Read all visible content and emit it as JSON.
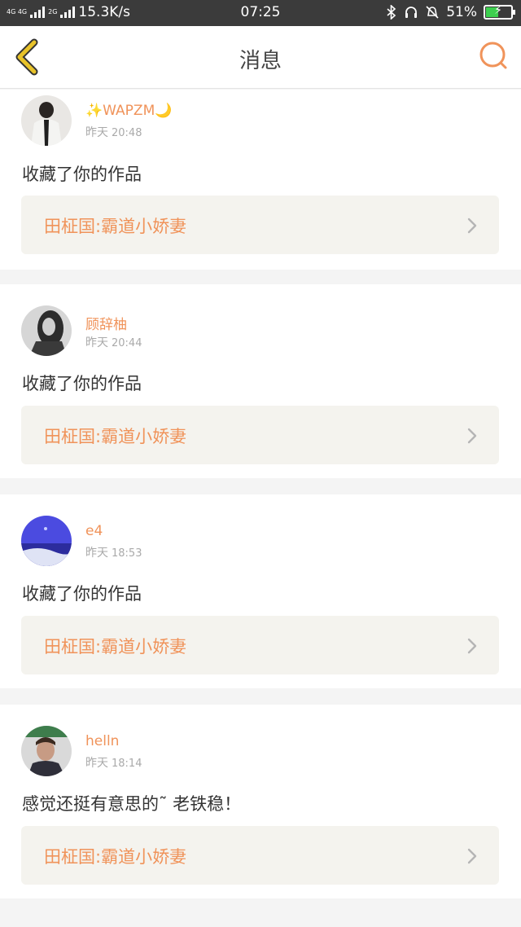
{
  "status_bar": {
    "network_left": "4G 4G",
    "network_right": "2G",
    "speed": "15.3K/s",
    "time": "07:25",
    "battery_percent": "51%",
    "battery_level": 0.51,
    "battery_color": "#3ccf4e"
  },
  "header": {
    "title": "消息",
    "back_icon": "chevron-left-icon",
    "search_icon": "search-icon",
    "accent_color": "#f0935a",
    "back_color": "#e8c32a"
  },
  "messages": [
    {
      "username": "✨WAPZM🌙",
      "day": "昨天",
      "time": "20:48",
      "text": "收藏了你的作品",
      "work_title": "田柾国:霸道小娇妻"
    },
    {
      "username": "顾辞柚",
      "day": "昨天",
      "time": "20:44",
      "text": "收藏了你的作品",
      "work_title": "田柾国:霸道小娇妻"
    },
    {
      "username": "e4",
      "day": "昨天",
      "time": "18:53",
      "text": "收藏了你的作品",
      "work_title": "田柾国:霸道小娇妻"
    },
    {
      "username": "helln",
      "day": "昨天",
      "time": "18:14",
      "text": "感觉还挺有意思的˜ 老铁稳！",
      "work_title": "田柾国:霸道小娇妻"
    }
  ]
}
